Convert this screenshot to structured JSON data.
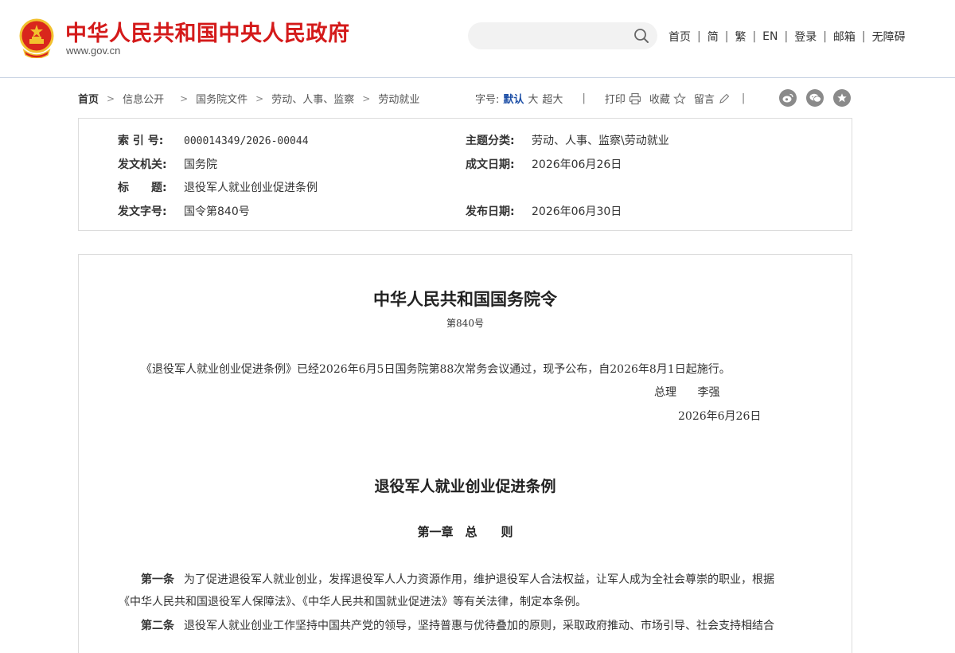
{
  "header": {
    "site_title": "中华人民共和国中央人民政府",
    "site_domain": "www.gov.cn",
    "search": {
      "value": "",
      "placeholder": ""
    },
    "nav": [
      {
        "label": "首页"
      },
      {
        "label": "简"
      },
      {
        "label": "繁"
      },
      {
        "label": "EN"
      },
      {
        "label": "登录"
      },
      {
        "label": "邮箱"
      },
      {
        "label": "无障碍"
      }
    ]
  },
  "breadcrumb": {
    "home": "首页",
    "items": [
      "信息公开",
      "国务院文件",
      "劳动、人事、监察",
      "劳动就业"
    ]
  },
  "tools": {
    "font_label": "字号:",
    "font_default": "默认",
    "font_large": "大",
    "font_xlarge": "超大",
    "print": "打印",
    "favorite": "收藏",
    "comment": "留言"
  },
  "info": {
    "index_label": "索 引 号:",
    "index_value": "000014349/2026-00044",
    "topic_label": "主题分类:",
    "topic_value": "劳动、人事、监察\\劳动就业",
    "issuer_label": "发文机关:",
    "issuer_value": "国务院",
    "written_label": "成文日期:",
    "written_value": "2026年06月26日",
    "title_label": "标　　题:",
    "title_value": "退役军人就业创业促进条例",
    "docno_label": "发文字号:",
    "docno_value": "国令第840号",
    "published_label": "发布日期:",
    "published_value": "2026年06月30日"
  },
  "article": {
    "decree_title": "中华人民共和国国务院令",
    "decree_no": "第840号",
    "intro": "《退役军人就业创业促进条例》已经2026年6月5日国务院第88次常务会议通过，现予公布，自2026年8月1日起施行。",
    "signer_title": "总理",
    "signer_name": "李强",
    "sign_date": "2026年6月26日",
    "reg_title": "退役军人就业创业促进条例",
    "chapter_title": "第一章　总　　则",
    "art1_label": "第一条",
    "art1_line1": "为了促进退役军人就业创业，发挥退役军人人力资源作用，维护退役军人合法权益，让军人成为全社会尊崇的职业，根据",
    "art1_line2": "《中华人民共和国退役军人保障法》、《中华人民共和国就业促进法》等有关法律，制定本条例。",
    "art2_label": "第二条",
    "art2_line1": "退役军人就业创业工作坚持中国共产党的领导，坚持普惠与优待叠加的原则，采取政府推动、市场引导、社会支持相结合"
  }
}
